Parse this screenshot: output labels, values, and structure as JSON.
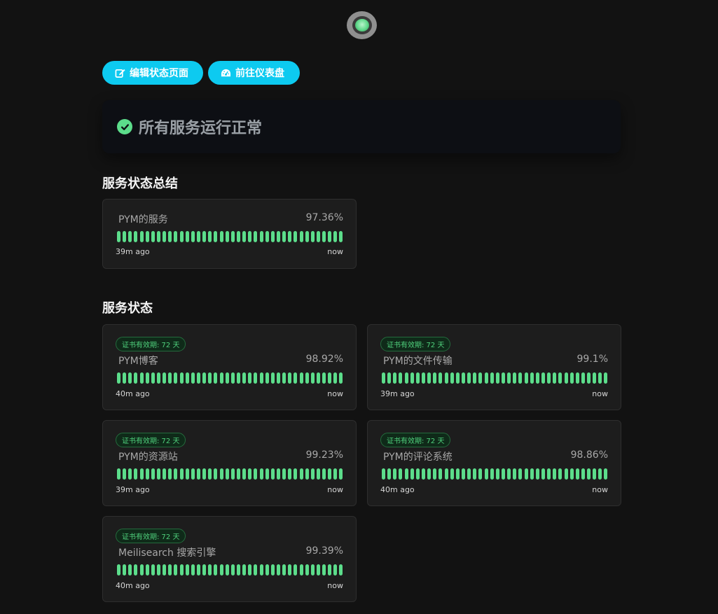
{
  "header": {
    "edit_label": "编辑状态页面",
    "dashboard_label": "前往仪表盘"
  },
  "overall": {
    "status_text": "所有服务运行正常",
    "accent": "#5cdd8b"
  },
  "summary": {
    "title": "服务状态总结",
    "monitor": {
      "name": "PYM的服务",
      "uptime": "97.36%",
      "start": "39m ago",
      "end": "now",
      "beats": 40
    }
  },
  "services": {
    "title": "服务状态",
    "monitors": [
      {
        "badge": "证书有效期: 72 天",
        "name": "PYM博客",
        "uptime": "98.92%",
        "start": "40m ago",
        "end": "now",
        "beats": 40
      },
      {
        "badge": "证书有效期: 72 天",
        "name": "PYM的文件传输",
        "uptime": "99.1%",
        "start": "39m ago",
        "end": "now",
        "beats": 40
      },
      {
        "badge": "证书有效期: 72 天",
        "name": "PYM的资源站",
        "uptime": "99.23%",
        "start": "39m ago",
        "end": "now",
        "beats": 40
      },
      {
        "badge": "证书有效期: 72 天",
        "name": "PYM的评论系统",
        "uptime": "98.86%",
        "start": "40m ago",
        "end": "now",
        "beats": 40
      },
      {
        "badge": "证书有效期: 72 天",
        "name": "Meilisearch 搜索引擎",
        "uptime": "99.39%",
        "start": "40m ago",
        "end": "now",
        "beats": 40
      }
    ]
  },
  "colors": {
    "beat_up": "#5cdd8b",
    "button": "#0dcaf0"
  }
}
